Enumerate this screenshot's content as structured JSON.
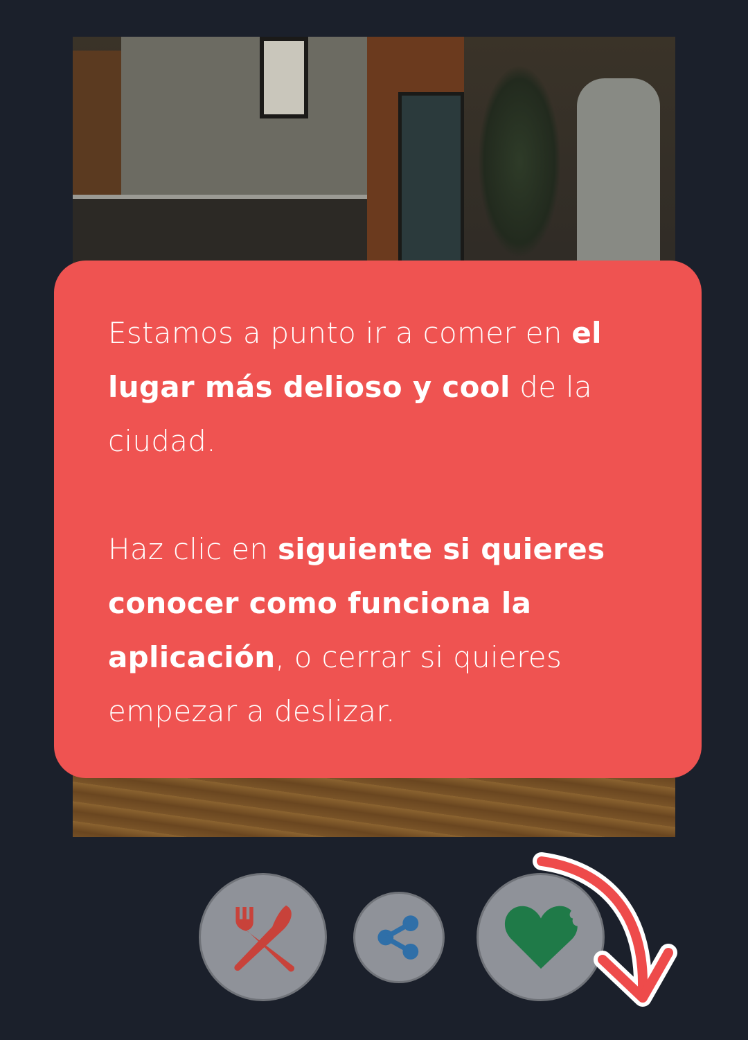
{
  "background_color": "#1b202b",
  "tutorial": {
    "card_color": "#ef5351",
    "paragraph1": {
      "part1": "Estamos a punto ir a comer en ",
      "bold1": "el lugar más delioso y cool",
      "part2": " de la ciudad."
    },
    "paragraph2": {
      "part1": "Haz clic en ",
      "bold1": "siguiente si quieres conocer como funciona la aplicación",
      "part2": ", o cerrar si quieres empezar a deslizar."
    }
  },
  "actions": {
    "dislike_icon": "fork-knife-cross-icon",
    "share_icon": "share-icon",
    "like_icon": "bitten-heart-icon",
    "dislike_color": "#c8423a",
    "share_color": "#2f6fa8",
    "like_color": "#1f7a48"
  },
  "hint_arrow_color": "#ee4b4b"
}
